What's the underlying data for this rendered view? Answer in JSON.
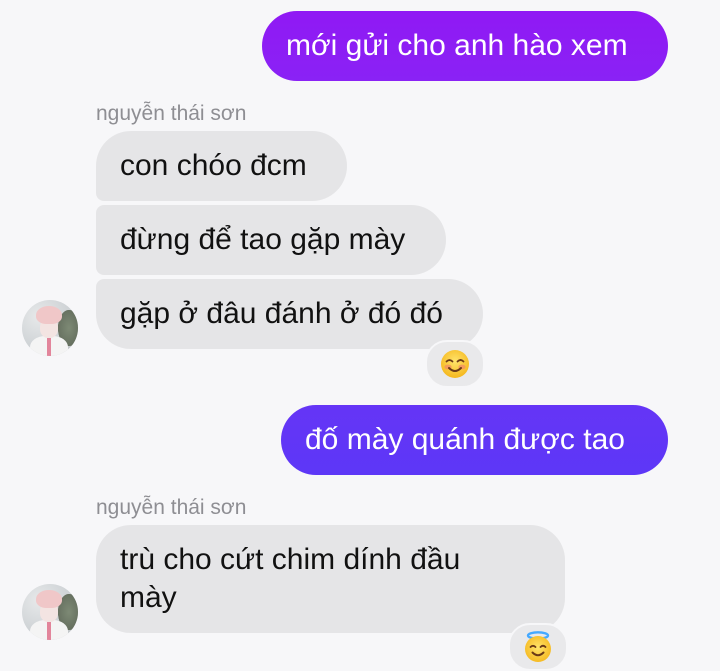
{
  "conversation": {
    "messages": [
      {
        "id": "m1",
        "direction": "outgoing",
        "text": "mới gửi cho anh hào xem"
      },
      {
        "id": "m2",
        "direction": "incoming",
        "sender": "nguyễn thái sơn",
        "text": "con chóo đcm"
      },
      {
        "id": "m3",
        "direction": "incoming",
        "text": "đừng để tao gặp mày"
      },
      {
        "id": "m4",
        "direction": "incoming",
        "text": "gặp ở đâu đánh ở đó đó",
        "reaction": "smiling-face-icon"
      },
      {
        "id": "m5",
        "direction": "outgoing",
        "text": "đố mày quánh được tao"
      },
      {
        "id": "m6",
        "direction": "incoming",
        "sender": "nguyễn thái sơn",
        "text_line1": "trù cho cứt chim dính đầu",
        "text_line2": "mày",
        "reaction": "halo-face-icon"
      }
    ]
  },
  "colors": {
    "outgoing_top": "#8a1cf5",
    "outgoing_bottom": "#5f36f7",
    "incoming": "#e5e5e7",
    "background": "#f7f7f9",
    "sender_name": "#8e8e93"
  }
}
